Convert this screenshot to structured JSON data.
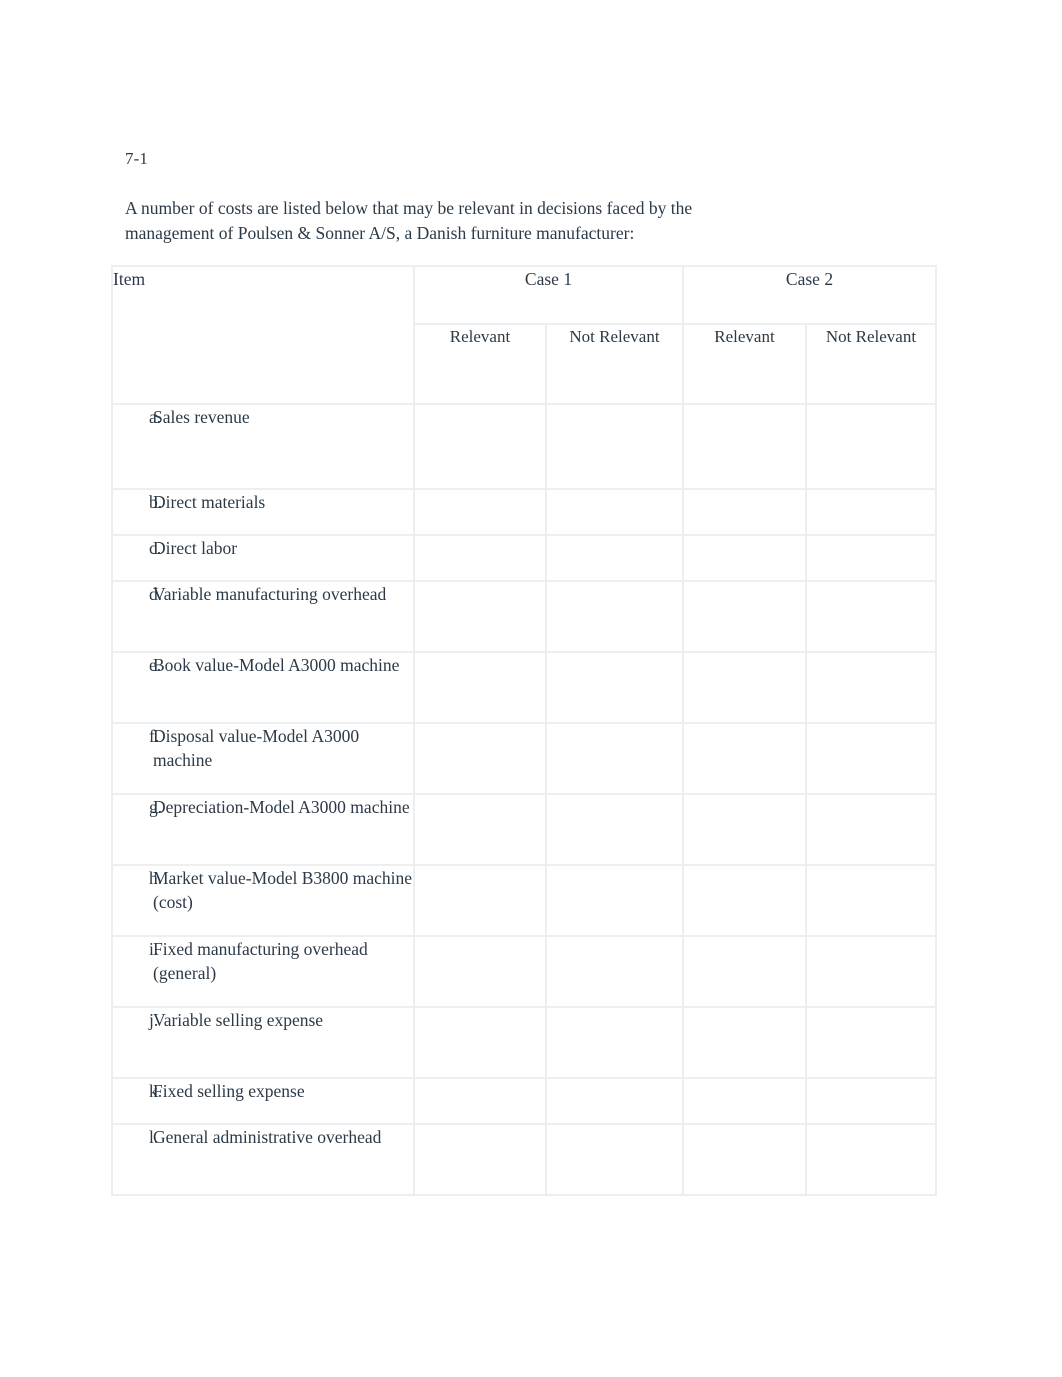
{
  "document": {
    "exercise_number": "7-1",
    "intro_line_1": "A number of costs are listed below that may be relevant in decisions faced by the",
    "intro_line_2": "management of Poulsen & Sonner A/S, a Danish furniture manufacturer:",
    "text_color": "#2c3a47",
    "grid_color": "#eceef0",
    "background_color": "#ffffff"
  },
  "table": {
    "item_header": "Item",
    "case_headers": [
      "Case 1",
      "Case 2"
    ],
    "sub_headers": [
      "Relevant",
      "Not Relevant",
      "Relevant",
      "Not Relevant"
    ],
    "rows": [
      {
        "letter": "a.",
        "label": "Sales revenue",
        "relevant_case1": "",
        "not_relevant_case1": "",
        "relevant_case2": "",
        "not_relevant_case2": ""
      },
      {
        "letter": "b.",
        "label": "Direct materials",
        "relevant_case1": "",
        "not_relevant_case1": "",
        "relevant_case2": "",
        "not_relevant_case2": ""
      },
      {
        "letter": "c.",
        "label": "Direct labor",
        "relevant_case1": "",
        "not_relevant_case1": "",
        "relevant_case2": "",
        "not_relevant_case2": ""
      },
      {
        "letter": "d.",
        "label": "Variable manufacturing overhead",
        "relevant_case1": "",
        "not_relevant_case1": "",
        "relevant_case2": "",
        "not_relevant_case2": ""
      },
      {
        "letter": "e.",
        "label": "Book value-Model A3000 machine",
        "relevant_case1": "",
        "not_relevant_case1": "",
        "relevant_case2": "",
        "not_relevant_case2": ""
      },
      {
        "letter": "f.",
        "label": "Disposal value-Model A3000 machine",
        "relevant_case1": "",
        "not_relevant_case1": "",
        "relevant_case2": "",
        "not_relevant_case2": ""
      },
      {
        "letter": "g.",
        "label": "Depreciation-Model A3000 machine",
        "relevant_case1": "",
        "not_relevant_case1": "",
        "relevant_case2": "",
        "not_relevant_case2": ""
      },
      {
        "letter": "h.",
        "label": "Market value-Model B3800 machine (cost)",
        "relevant_case1": "",
        "not_relevant_case1": "",
        "relevant_case2": "",
        "not_relevant_case2": ""
      },
      {
        "letter": "i.",
        "label": "Fixed manufacturing overhead (general)",
        "relevant_case1": "",
        "not_relevant_case1": "",
        "relevant_case2": "",
        "not_relevant_case2": ""
      },
      {
        "letter": "j.",
        "label": "Variable selling expense",
        "relevant_case1": "",
        "not_relevant_case1": "",
        "relevant_case2": "",
        "not_relevant_case2": ""
      },
      {
        "letter": "k.",
        "label": "Fixed selling expense",
        "relevant_case1": "",
        "not_relevant_case1": "",
        "relevant_case2": "",
        "not_relevant_case2": ""
      },
      {
        "letter": "l.",
        "label": "General administrative overhead",
        "relevant_case1": "",
        "not_relevant_case1": "",
        "relevant_case2": "",
        "not_relevant_case2": ""
      }
    ]
  }
}
